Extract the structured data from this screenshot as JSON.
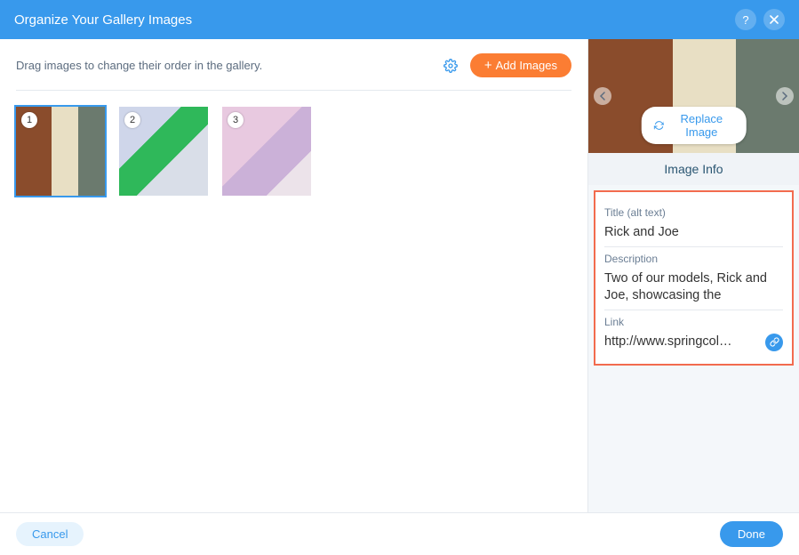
{
  "header": {
    "title": "Organize Your Gallery Images",
    "help": "?"
  },
  "left": {
    "instructions": "Drag images to change their order in the gallery.",
    "add_label": "Add Images"
  },
  "thumbs": [
    {
      "num": "1",
      "selected": true
    },
    {
      "num": "2",
      "selected": false
    },
    {
      "num": "3",
      "selected": false
    }
  ],
  "sidebar": {
    "replace_label": "Replace Image",
    "info_header": "Image Info",
    "fields": {
      "title_label": "Title (alt text)",
      "title_value": "Rick and Joe",
      "desc_label": "Description",
      "desc_value": "Two of our models, Rick and Joe, showcasing the",
      "link_label": "Link",
      "link_value": "http://www.springcol…"
    }
  },
  "footer": {
    "cancel": "Cancel",
    "done": "Done"
  },
  "colors": {
    "accent": "#3899ec",
    "add_button": "#fb7d33",
    "highlight_border": "#f26b4e"
  }
}
